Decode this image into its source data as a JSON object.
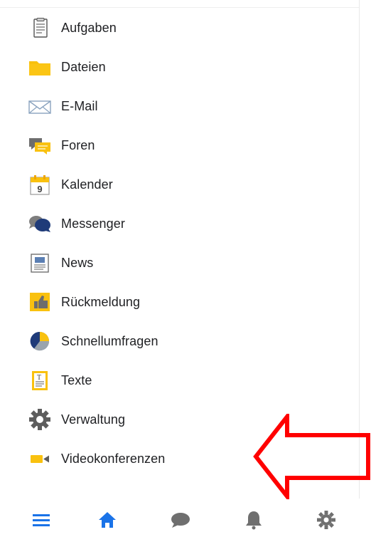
{
  "menu": {
    "items": [
      {
        "label": "Aufgaben",
        "icon": "clipboard-icon"
      },
      {
        "label": "Dateien",
        "icon": "folder-icon"
      },
      {
        "label": "E-Mail",
        "icon": "envelope-icon"
      },
      {
        "label": "Foren",
        "icon": "forum-bubbles-icon"
      },
      {
        "label": "Kalender",
        "icon": "calendar-icon",
        "calendar_day": "9"
      },
      {
        "label": "Messenger",
        "icon": "chat-bubbles-icon"
      },
      {
        "label": "News",
        "icon": "newspaper-icon"
      },
      {
        "label": "Rückmeldung",
        "icon": "thumbs-up-icon"
      },
      {
        "label": "Schnellumfragen",
        "icon": "pie-chart-icon"
      },
      {
        "label": "Texte",
        "icon": "text-document-icon"
      },
      {
        "label": "Verwaltung",
        "icon": "gear-icon"
      },
      {
        "label": "Videokonferenzen",
        "icon": "video-camera-icon"
      }
    ]
  },
  "bottom_nav": [
    {
      "icon": "hamburger-menu-icon",
      "active": true
    },
    {
      "icon": "home-icon",
      "active": true
    },
    {
      "icon": "chat-icon",
      "active": false
    },
    {
      "icon": "bell-icon",
      "active": false
    },
    {
      "icon": "settings-gear-icon",
      "active": false
    }
  ],
  "colors": {
    "accent": "#1a73e8",
    "nav_inactive": "#6f6f6f",
    "folder_yellow": "#f9c10f",
    "annotation_red": "#ff0000"
  }
}
